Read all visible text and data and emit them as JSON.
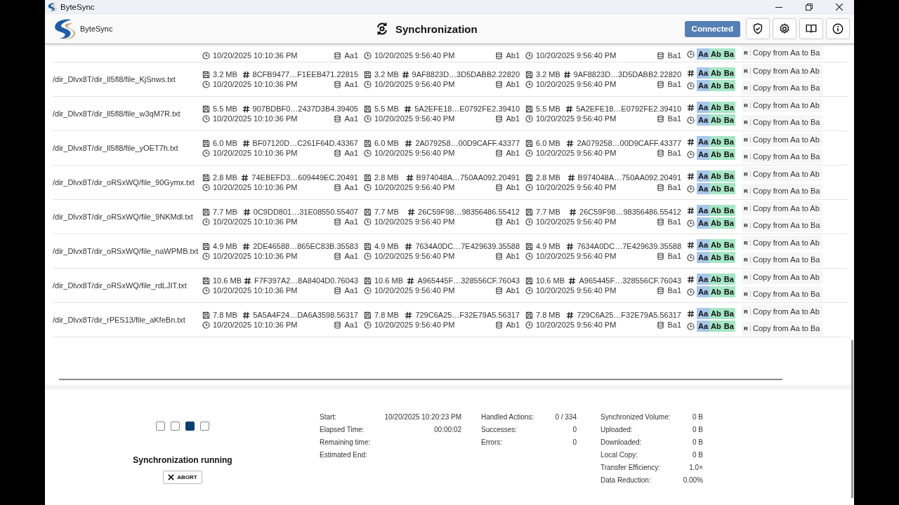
{
  "window": {
    "title": "ByteSync"
  },
  "header": {
    "app_name": "ByteSync",
    "title": "Synchronization",
    "status": "Connected"
  },
  "rows": [
    {
      "partial": true,
      "sources": [
        {
          "date": "10/20/2025 10:10:36 PM",
          "location": "Aa1"
        },
        {
          "date": "10/20/2025 9:56:40 PM",
          "location": "Ab1"
        },
        {
          "date": "10/20/2025 9:56:40 PM",
          "location": "Ba1"
        }
      ],
      "comparisons": [
        {
          "kind": "date",
          "badges": [
            {
              "label": "Aa",
              "color": "#a7c6ea"
            },
            {
              "label": "Ab",
              "color": "#a5e6c5"
            },
            {
              "label": "Ba",
              "color": "#a5e6c5"
            }
          ]
        }
      ],
      "actions": [
        {
          "flag": "R",
          "label": "Copy from Aa to Ba"
        }
      ]
    },
    {
      "path": "/dir_Dlvx8T/dir_Il5fl8/file_KjSnws.txt",
      "sources": [
        {
          "size": "3.2 MB",
          "hash": "8CFB9477…F1EEB471.22815",
          "date": "10/20/2025 10:10:36 PM",
          "location": "Aa1"
        },
        {
          "size": "3.2 MB",
          "hash": "9AF8823D…3D5DABB2.22820",
          "date": "10/20/2025 9:56:40 PM",
          "location": "Ab1"
        },
        {
          "size": "3.2 MB",
          "hash": "9AF8823D…3D5DABB2.22820",
          "date": "10/20/2025 9:56:40 PM",
          "location": "Ba1"
        }
      ],
      "comparisons": [
        {
          "kind": "hash",
          "badges": [
            {
              "label": "Aa",
              "color": "#a7c6ea"
            },
            {
              "label": "Ab",
              "color": "#a5e6c5"
            },
            {
              "label": "Ba",
              "color": "#a5e6c5"
            }
          ]
        },
        {
          "kind": "date",
          "badges": [
            {
              "label": "Aa",
              "color": "#a7c6ea"
            },
            {
              "label": "Ab",
              "color": "#a5e6c5"
            },
            {
              "label": "Ba",
              "color": "#a5e6c5"
            }
          ]
        }
      ],
      "actions": [
        {
          "flag": "R",
          "label": "Copy from Aa to Ab"
        },
        {
          "flag": "R",
          "label": "Copy from Aa to Ba"
        }
      ]
    },
    {
      "path": "/dir_Dlvx8T/dir_Il5fl8/file_w3qM7R.txt",
      "sources": [
        {
          "size": "5.5 MB",
          "hash": "907BDBF0…2437D3B4.39405",
          "date": "10/20/2025 10:10:36 PM",
          "location": "Aa1"
        },
        {
          "size": "5.5 MB",
          "hash": "5A2EFE18…E0792FE2.39410",
          "date": "10/20/2025 9:56:40 PM",
          "location": "Ab1"
        },
        {
          "size": "5.5 MB",
          "hash": "5A2EFE18…E0792FE2.39410",
          "date": "10/20/2025 9:56:40 PM",
          "location": "Ba1"
        }
      ],
      "comparisons": [
        {
          "kind": "hash",
          "badges": [
            {
              "label": "Aa",
              "color": "#a7c6ea"
            },
            {
              "label": "Ab",
              "color": "#a5e6c5"
            },
            {
              "label": "Ba",
              "color": "#a5e6c5"
            }
          ]
        },
        {
          "kind": "date",
          "badges": [
            {
              "label": "Aa",
              "color": "#a7c6ea"
            },
            {
              "label": "Ab",
              "color": "#a5e6c5"
            },
            {
              "label": "Ba",
              "color": "#a5e6c5"
            }
          ]
        }
      ],
      "actions": [
        {
          "flag": "R",
          "label": "Copy from Aa to Ab"
        },
        {
          "flag": "R",
          "label": "Copy from Aa to Ba"
        }
      ]
    },
    {
      "path": "/dir_Dlvx8T/dir_Il5fl8/file_yOET7h.txt",
      "sources": [
        {
          "size": "6.0 MB",
          "hash": "BF07120D…C261F64D.43367",
          "date": "10/20/2025 10:10:36 PM",
          "location": "Aa1"
        },
        {
          "size": "6.0 MB",
          "hash": "2A079258…00D9CAFF.43377",
          "date": "10/20/2025 9:56:40 PM",
          "location": "Ab1"
        },
        {
          "size": "6.0 MB",
          "hash": "2A079258…00D9CAFF.43377",
          "date": "10/20/2025 9:56:40 PM",
          "location": "Ba1"
        }
      ],
      "comparisons": [
        {
          "kind": "hash",
          "badges": [
            {
              "label": "Aa",
              "color": "#a7c6ea"
            },
            {
              "label": "Ab",
              "color": "#a5e6c5"
            },
            {
              "label": "Ba",
              "color": "#a5e6c5"
            }
          ]
        },
        {
          "kind": "date",
          "badges": [
            {
              "label": "Aa",
              "color": "#a7c6ea"
            },
            {
              "label": "Ab",
              "color": "#a5e6c5"
            },
            {
              "label": "Ba",
              "color": "#a5e6c5"
            }
          ]
        }
      ],
      "actions": [
        {
          "flag": "R",
          "label": "Copy from Aa to Ab"
        },
        {
          "flag": "R",
          "label": "Copy from Aa to Ba"
        }
      ]
    },
    {
      "path": "/dir_Dlvx8T/dir_oRSxWQ/file_90Gymx.txt",
      "sources": [
        {
          "size": "2.8 MB",
          "hash": "74EBEFD3…609449EC.20491",
          "date": "10/20/2025 10:10:36 PM",
          "location": "Aa1"
        },
        {
          "size": "2.8 MB",
          "hash": "B974048A…750AA092.20491",
          "date": "10/20/2025 9:56:40 PM",
          "location": "Ab1"
        },
        {
          "size": "2.8 MB",
          "hash": "B974048A…750AA092.20491",
          "date": "10/20/2025 9:56:40 PM",
          "location": "Ba1"
        }
      ],
      "comparisons": [
        {
          "kind": "hash",
          "badges": [
            {
              "label": "Aa",
              "color": "#a7c6ea"
            },
            {
              "label": "Ab",
              "color": "#a5e6c5"
            },
            {
              "label": "Ba",
              "color": "#a5e6c5"
            }
          ]
        },
        {
          "kind": "date",
          "badges": [
            {
              "label": "Aa",
              "color": "#a7c6ea"
            },
            {
              "label": "Ab",
              "color": "#a5e6c5"
            },
            {
              "label": "Ba",
              "color": "#a5e6c5"
            }
          ]
        }
      ],
      "actions": [
        {
          "flag": "R",
          "label": "Copy from Aa to Ab"
        },
        {
          "flag": "R",
          "label": "Copy from Aa to Ba"
        }
      ]
    },
    {
      "path": "/dir_Dlvx8T/dir_oRSxWQ/file_9NKMdl.txt",
      "sources": [
        {
          "size": "7.7 MB",
          "hash": "0C9DD801…31E08550.55407",
          "date": "10/20/2025 10:10:36 PM",
          "location": "Aa1"
        },
        {
          "size": "7.7 MB",
          "hash": "26C59F98…98356486.55412",
          "date": "10/20/2025 9:56:40 PM",
          "location": "Ab1"
        },
        {
          "size": "7.7 MB",
          "hash": "26C59F98…98356486.55412",
          "date": "10/20/2025 9:56:40 PM",
          "location": "Ba1"
        }
      ],
      "comparisons": [
        {
          "kind": "hash",
          "badges": [
            {
              "label": "Aa",
              "color": "#a7c6ea"
            },
            {
              "label": "Ab",
              "color": "#a5e6c5"
            },
            {
              "label": "Ba",
              "color": "#a5e6c5"
            }
          ]
        },
        {
          "kind": "date",
          "badges": [
            {
              "label": "Aa",
              "color": "#a7c6ea"
            },
            {
              "label": "Ab",
              "color": "#a5e6c5"
            },
            {
              "label": "Ba",
              "color": "#a5e6c5"
            }
          ]
        }
      ],
      "actions": [
        {
          "flag": "R",
          "label": "Copy from Aa to Ab"
        },
        {
          "flag": "R",
          "label": "Copy from Aa to Ba"
        }
      ]
    },
    {
      "path": "/dir_Dlvx8T/dir_oRSxWQ/file_naWPMB.txt",
      "sources": [
        {
          "size": "4.9 MB",
          "hash": "2DE46588…865EC83B.35583",
          "date": "10/20/2025 10:10:36 PM",
          "location": "Aa1"
        },
        {
          "size": "4.9 MB",
          "hash": "7634A0DC…7E429639.35588",
          "date": "10/20/2025 9:56:40 PM",
          "location": "Ab1"
        },
        {
          "size": "4.9 MB",
          "hash": "7634A0DC…7E429639.35588",
          "date": "10/20/2025 9:56:40 PM",
          "location": "Ba1"
        }
      ],
      "comparisons": [
        {
          "kind": "hash",
          "badges": [
            {
              "label": "Aa",
              "color": "#a7c6ea"
            },
            {
              "label": "Ab",
              "color": "#a5e6c5"
            },
            {
              "label": "Ba",
              "color": "#a5e6c5"
            }
          ]
        },
        {
          "kind": "date",
          "badges": [
            {
              "label": "Aa",
              "color": "#a7c6ea"
            },
            {
              "label": "Ab",
              "color": "#a5e6c5"
            },
            {
              "label": "Ba",
              "color": "#a5e6c5"
            }
          ]
        }
      ],
      "actions": [
        {
          "flag": "R",
          "label": "Copy from Aa to Ab"
        },
        {
          "flag": "R",
          "label": "Copy from Aa to Ba"
        }
      ]
    },
    {
      "path": "/dir_Dlvx8T/dir_oRSxWQ/file_rdLJIT.txt",
      "sources": [
        {
          "size": "10.6 MB",
          "hash": "F7F397A2…8A8404D0.76043",
          "date": "10/20/2025 10:10:36 PM",
          "location": "Aa1"
        },
        {
          "size": "10.6 MB",
          "hash": "A965445F…328556CF.76043",
          "date": "10/20/2025 9:56:40 PM",
          "location": "Ab1"
        },
        {
          "size": "10.6 MB",
          "hash": "A965445F…328556CF.76043",
          "date": "10/20/2025 9:56:40 PM",
          "location": "Ba1"
        }
      ],
      "comparisons": [
        {
          "kind": "hash",
          "badges": [
            {
              "label": "Aa",
              "color": "#a7c6ea"
            },
            {
              "label": "Ab",
              "color": "#a5e6c5"
            },
            {
              "label": "Ba",
              "color": "#a5e6c5"
            }
          ]
        },
        {
          "kind": "date",
          "badges": [
            {
              "label": "Aa",
              "color": "#a7c6ea"
            },
            {
              "label": "Ab",
              "color": "#a5e6c5"
            },
            {
              "label": "Ba",
              "color": "#a5e6c5"
            }
          ]
        }
      ],
      "actions": [
        {
          "flag": "R",
          "label": "Copy from Aa to Ab"
        },
        {
          "flag": "R",
          "label": "Copy from Aa to Ba"
        }
      ]
    },
    {
      "path": "/dir_Dlvx8T/dir_rPES13/file_aKfeBn.txt",
      "sources": [
        {
          "size": "7.8 MB",
          "hash": "5A5A4F24…DA6A3598.56317",
          "date": "10/20/2025 10:10:36 PM",
          "location": "Aa1"
        },
        {
          "size": "7.8 MB",
          "hash": "729C6A25…F32E79A5.56317",
          "date": "10/20/2025 9:56:40 PM",
          "location": "Ab1"
        },
        {
          "size": "7.8 MB",
          "hash": "729C6A25…F32E79A5.56317",
          "date": "10/20/2025 9:56:40 PM",
          "location": "Ba1"
        }
      ],
      "comparisons": [
        {
          "kind": "hash",
          "badges": [
            {
              "label": "Aa",
              "color": "#a7c6ea"
            },
            {
              "label": "Ab",
              "color": "#a5e6c5"
            },
            {
              "label": "Ba",
              "color": "#a5e6c5"
            }
          ]
        },
        {
          "kind": "date",
          "badges": [
            {
              "label": "Aa",
              "color": "#a7c6ea"
            },
            {
              "label": "Ab",
              "color": "#a5e6c5"
            },
            {
              "label": "Ba",
              "color": "#a5e6c5"
            }
          ]
        }
      ],
      "actions": [
        {
          "flag": "R",
          "label": "Copy from Aa to Ab"
        },
        {
          "flag": "R",
          "label": "Copy from Aa to Ba"
        }
      ]
    }
  ],
  "progress": {
    "steps": [
      {
        "filled": false
      },
      {
        "filled": false
      },
      {
        "filled": true
      },
      {
        "filled": false
      }
    ],
    "status": "Synchronization running",
    "abort": "ABORT"
  },
  "stats": [
    [
      {
        "label": "Start:",
        "value": "10/20/2025 10:20:23 PM"
      },
      {
        "label": "Elapsed Time:",
        "value": "00:00:02"
      },
      {
        "label": "Remaining time:"
      },
      {
        "label": "Estimated End:"
      }
    ],
    [
      {
        "label": "Handled Actions:",
        "value": "0 / 334"
      },
      {
        "label": "Successes:",
        "value": "0"
      },
      {
        "label": "Errors:",
        "value": "0"
      }
    ],
    [
      {
        "label": "Synchronized Volume:",
        "value": "0 B"
      },
      {
        "label": "Uploaded:",
        "value": "0 B"
      },
      {
        "label": "Downloaded:",
        "value": "0 B"
      },
      {
        "label": "Local Copy:",
        "value": "0 B"
      },
      {
        "label": "Transfer Efficiency:",
        "value": "1.0×"
      },
      {
        "label": "Data Reduction:",
        "value": "0.00%"
      }
    ]
  ]
}
